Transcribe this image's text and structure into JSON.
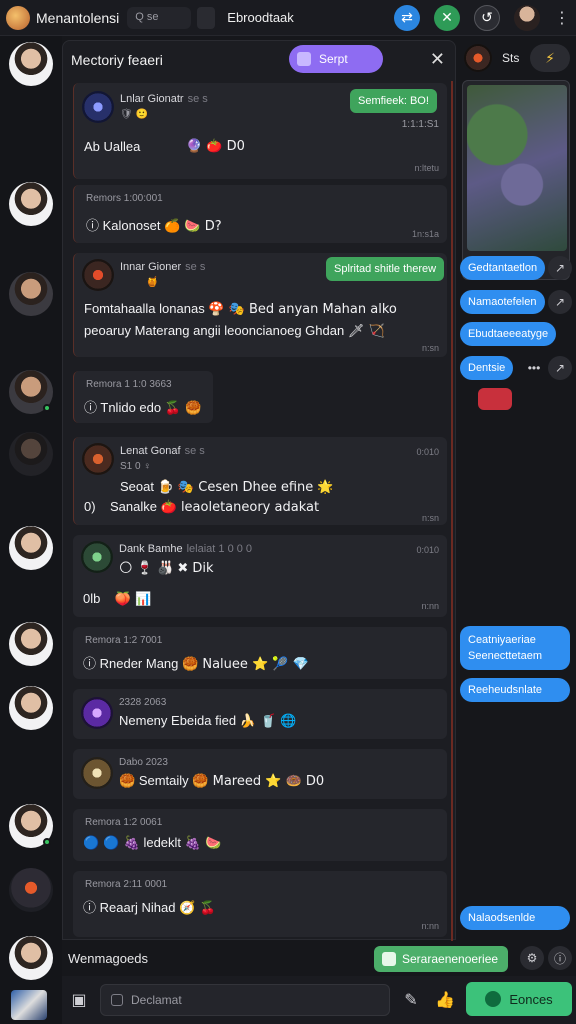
{
  "topbar": {
    "app_title": "Menantolensi",
    "search_placeholder": "Q se",
    "tab_label": "Ebroodtaak",
    "btn_blue_icon": "share-icon",
    "btn_green_icon": "close-icon",
    "btn_grey_icon": "history-icon",
    "menu_icon": "more-icon"
  },
  "chat": {
    "title": "Mectoriy feaeri",
    "pill_label": "Serpt",
    "close": "✕",
    "messages": [
      {
        "name": "Lnlar Gionatr",
        "sub": "se s",
        "emoji": "🛡 🙂",
        "body": "Ab     Uallea",
        "tail": "🔮 🍅 D0",
        "tag": "Semfieek: BO!",
        "time1": "1:1:1:S1",
        "time2": "n:ltetu"
      },
      {
        "header": "Remors 1:00:001",
        "body": "Kalonoset",
        "tail": "🍊 🍉 D?",
        "time": "1n:s1a"
      },
      {
        "name": "Innar Gioner",
        "sub": "se s",
        "emoji": "🍯",
        "tag": "Splritad shitle therew",
        "line1": "Fomtahaalla lonanas",
        "line1_tail": "🍄 🎭 Bed anyan Mahan alko",
        "line2": "peoaruy Materang angii leooncianoeg Ghdan",
        "line2_tail": "🗡 🏹",
        "time": "n:sn"
      },
      {
        "header": "Remora 1 1:0 3663",
        "body": "Tnlido edo",
        "tail": "🍒 🥮"
      },
      {
        "name": "Lenat Gonaf",
        "sub": "se s",
        "small": "S1 0 ♀",
        "time_r": "0:010",
        "line1": "Seoat",
        "line1_tail": "🍺 🎭 Cesen Dhee efine 🌟",
        "prefix": "0)",
        "line2": "Sanalke",
        "line2_tail": "🍅 leaoletaneory adakat",
        "time": "n:sn"
      },
      {
        "name": "Dank Bamhe",
        "sub": "lelaiat 1 0 0 0",
        "time_r": "0:010",
        "line1_tail": "🌕 🍷 🎳 ✖ Dik",
        "prefix": "0lb",
        "line2_tail": "🍑 📊",
        "time": "n:nn"
      },
      {
        "header": "Remora 1:2 7001",
        "body": "Rneder Mang",
        "tail": "🥮 Naluee ⭐ 🎾 💎"
      },
      {
        "header": "2328 2063",
        "body": "Nemeny Ebeida fied",
        "tail": "🍌 🥤 🌐"
      },
      {
        "header": "Dabo 2023",
        "body": "Semtaily",
        "tail": "🥮 Mareed ⭐ 🍩 D0",
        "prefix": "🥮"
      },
      {
        "header": "Remora 1:2 0061",
        "body": "ledeklt",
        "tail": "🍇 🍉",
        "prefix": "🔵 🔵 🍇"
      },
      {
        "header": "Remora 2:11 0001",
        "body": "Reaarj Nihad",
        "tail": "🧭 🍒",
        "time": "n:nn"
      }
    ]
  },
  "right_panel": {
    "title": "Sts",
    "btn_icon": "⚡",
    "bubbles": [
      "Gedtantaetlon",
      "Namaotefelen",
      "Ebudtaeeeatyge",
      "Dentsie",
      "Ceatniyaeriae Seenecttetaem",
      "Reeheudsnlate",
      "Nalaodsenlde"
    ]
  },
  "bottom": {
    "status_text": "Wenmagoeds",
    "green_pill": "Seraraenenoeriee",
    "input_placeholder": "Declamat",
    "send_label": "Eonces"
  }
}
